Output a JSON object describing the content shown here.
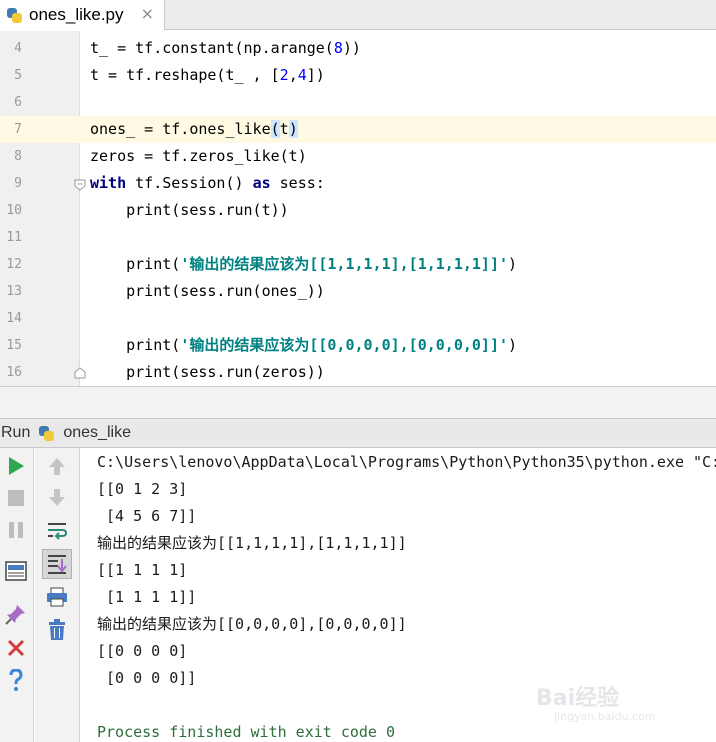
{
  "editor_tab": {
    "filename": "ones_like.py",
    "close_glyph": "×"
  },
  "editor": {
    "lines": [
      {
        "num": "4",
        "text": "t_ = tf.constant(np.arange(8))"
      },
      {
        "num": "5",
        "text": "t = tf.reshape(t_ , [2,4])"
      },
      {
        "num": "6",
        "text": ""
      },
      {
        "num": "7",
        "text": "ones_ = tf.ones_like(t)"
      },
      {
        "num": "8",
        "text": "zeros = tf.zeros_like(t)"
      },
      {
        "num": "9",
        "text": "with tf.Session() as sess:"
      },
      {
        "num": "10",
        "text": "    print(sess.run(t))"
      },
      {
        "num": "11",
        "text": ""
      },
      {
        "num": "12",
        "text": "    print('输出的结果应该为[[1,1,1,1],[1,1,1,1]]')"
      },
      {
        "num": "13",
        "text": "    print(sess.run(ones_))"
      },
      {
        "num": "14",
        "text": ""
      },
      {
        "num": "15",
        "text": "    print('输出的结果应该为[[0,0,0,0],[0,0,0,0]]')"
      },
      {
        "num": "16",
        "text": "    print(sess.run(zeros))"
      }
    ],
    "current_line": "7"
  },
  "run_bar": {
    "label": "Run",
    "config_name": "ones_like"
  },
  "console": {
    "lines": [
      "C:\\Users\\lenovo\\AppData\\Local\\Programs\\Python\\Python35\\python.exe \"C:",
      "[[0 1 2 3]",
      " [4 5 6 7]]",
      "输出的结果应该为[[1,1,1,1],[1,1,1,1]]",
      "[[1 1 1 1]",
      " [1 1 1 1]]",
      "输出的结果应该为[[0,0,0,0],[0,0,0,0]]",
      "[[0 0 0 0]",
      " [0 0 0 0]]",
      "",
      "Process finished with exit code 0"
    ]
  },
  "watermark": {
    "brand": "Bai经验",
    "url": "jingyan.baidu.com"
  },
  "colors": {
    "keyword": "#000080",
    "number": "#0000ff",
    "string": "#008080",
    "run_green": "#2fa84f",
    "stop_red": "#d63b3b"
  }
}
